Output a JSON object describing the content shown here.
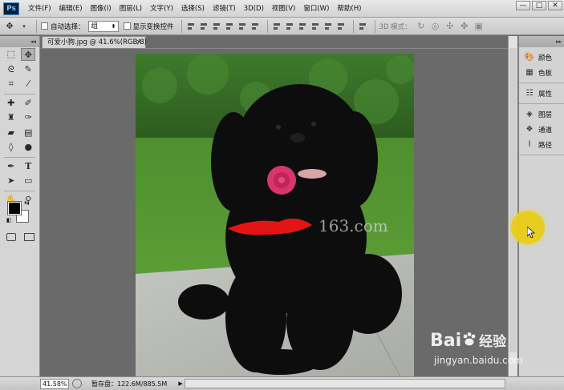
{
  "app": {
    "logo_text": "Ps",
    "menus": [
      "文件(F)",
      "编辑(E)",
      "图像(I)",
      "图层(L)",
      "文字(Y)",
      "选择(S)",
      "滤镜(T)",
      "3D(D)",
      "视图(V)",
      "窗口(W)",
      "帮助(H)"
    ],
    "window_controls": [
      "—",
      "□",
      "✕"
    ]
  },
  "options_bar": {
    "auto_select_label": "自动选择：",
    "auto_select_value": "组",
    "show_transform_label": "显示变换控件",
    "mode_3d_label": "3D 模式："
  },
  "document": {
    "tab_title": "可爱小狗.jpg @ 41.6%(RGB/8)",
    "close_glyph": "×",
    "image_watermark_text": "163.com"
  },
  "panels": {
    "group1": [
      {
        "icon": "palette-icon",
        "label": "颜色"
      },
      {
        "icon": "swatches-icon",
        "label": "色板"
      }
    ],
    "group2": [
      {
        "icon": "properties-icon",
        "label": "属性"
      }
    ],
    "group3": [
      {
        "icon": "layers-icon",
        "label": "图层"
      },
      {
        "icon": "channels-icon",
        "label": "通道"
      },
      {
        "icon": "paths-icon",
        "label": "路径"
      }
    ]
  },
  "status_bar": {
    "zoom": "41.58%",
    "doc_size": "暂存盘：122.6M/885.5M",
    "arrow": "▶"
  },
  "watermark": {
    "logo": "Bai",
    "logo_suffix": "经验",
    "url": "jingyan.baidu.com"
  },
  "colors": {
    "foreground": "#000000",
    "background": "#ffffff",
    "highlight": "#e8cd14"
  }
}
